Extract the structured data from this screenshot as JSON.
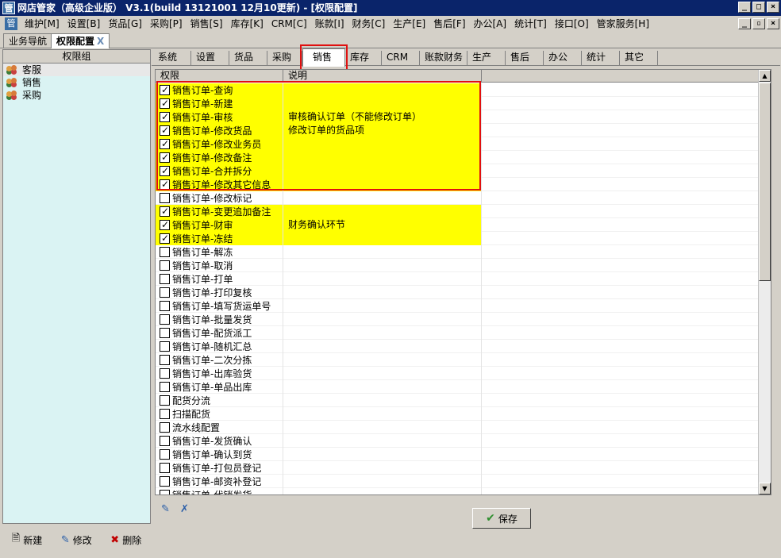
{
  "window": {
    "title": "网店管家（高级企业版） V3.1(build 13121001 12月10更新) - [权限配置]",
    "app_icon": "管",
    "controls": [
      "_",
      "□",
      "×"
    ],
    "mdi_controls": [
      "_",
      "▫",
      "×"
    ]
  },
  "menubar": {
    "icon": "管",
    "items": [
      "维护[M]",
      "设置[B]",
      "货品[G]",
      "采购[P]",
      "销售[S]",
      "库存[K]",
      "CRM[C]",
      "账款[I]",
      "财务[C]",
      "生产[E]",
      "售后[F]",
      "办公[A]",
      "统计[T]",
      "接口[O]",
      "管家服务[H]"
    ]
  },
  "doc_tabs": [
    {
      "label": "业务导航",
      "active": false
    },
    {
      "label": "权限配置",
      "active": true,
      "close": "X"
    }
  ],
  "left_panel": {
    "header": "权限组",
    "groups": [
      {
        "label": "客服",
        "selected": true
      },
      {
        "label": "销售",
        "selected": false
      },
      {
        "label": "采购",
        "selected": false
      }
    ],
    "buttons": {
      "new": "新建",
      "edit": "修改",
      "delete": "删除"
    }
  },
  "category_tabs": [
    "系统",
    "设置",
    "货品",
    "采购",
    "销售",
    "库存",
    "CRM",
    "账款财务",
    "生产",
    "售后",
    "办公",
    "统计",
    "其它"
  ],
  "active_category": "销售",
  "grid": {
    "columns": {
      "permission": "权限",
      "description": "说明"
    },
    "rows": [
      {
        "permission": "销售订单-查询",
        "description": "",
        "checked": true
      },
      {
        "permission": "销售订单-新建",
        "description": "",
        "checked": true
      },
      {
        "permission": "销售订单-审核",
        "description": "审核确认订单（不能修改订单）",
        "checked": true
      },
      {
        "permission": "销售订单-修改货品",
        "description": "修改订单的货品项",
        "checked": true
      },
      {
        "permission": "销售订单-修改业务员",
        "description": "",
        "checked": true
      },
      {
        "permission": "销售订单-修改备注",
        "description": "",
        "checked": true
      },
      {
        "permission": "销售订单-合并拆分",
        "description": "",
        "checked": true
      },
      {
        "permission": "销售订单-修改其它信息",
        "description": "",
        "checked": true
      },
      {
        "permission": "销售订单-修改标记",
        "description": "",
        "checked": false
      },
      {
        "permission": "销售订单-变更追加备注",
        "description": "",
        "checked": true
      },
      {
        "permission": "销售订单-财审",
        "description": "财务确认环节",
        "checked": true
      },
      {
        "permission": "销售订单-冻结",
        "description": "",
        "checked": true
      },
      {
        "permission": "销售订单-解冻",
        "description": "",
        "checked": false
      },
      {
        "permission": "销售订单-取消",
        "description": "",
        "checked": false
      },
      {
        "permission": "销售订单-打单",
        "description": "",
        "checked": false
      },
      {
        "permission": "销售订单-打印复核",
        "description": "",
        "checked": false
      },
      {
        "permission": "销售订单-填写货运单号",
        "description": "",
        "checked": false
      },
      {
        "permission": "销售订单-批量发货",
        "description": "",
        "checked": false
      },
      {
        "permission": "销售订单-配货派工",
        "description": "",
        "checked": false
      },
      {
        "permission": "销售订单-随机汇总",
        "description": "",
        "checked": false
      },
      {
        "permission": "销售订单-二次分拣",
        "description": "",
        "checked": false
      },
      {
        "permission": "销售订单-出库验货",
        "description": "",
        "checked": false
      },
      {
        "permission": "销售订单-单品出库",
        "description": "",
        "checked": false
      },
      {
        "permission": "配货分流",
        "description": "",
        "checked": false
      },
      {
        "permission": "扫描配货",
        "description": "",
        "checked": false
      },
      {
        "permission": "流水线配置",
        "description": "",
        "checked": false
      },
      {
        "permission": "销售订单-发货确认",
        "description": "",
        "checked": false
      },
      {
        "permission": "销售订单-确认到货",
        "description": "",
        "checked": false
      },
      {
        "permission": "销售订单-打包员登记",
        "description": "",
        "checked": false
      },
      {
        "permission": "销售订单-邮资补登记",
        "description": "",
        "checked": false
      },
      {
        "permission": "销售订单-代销发货",
        "description": "",
        "checked": false
      }
    ]
  },
  "toolbar": {
    "save_label": "保存"
  },
  "colors": {
    "highlight": "#ffff00",
    "annotation_box": "#e01010",
    "title_bar": "#0a246a",
    "left_panel_bg": "#daf3f3"
  }
}
